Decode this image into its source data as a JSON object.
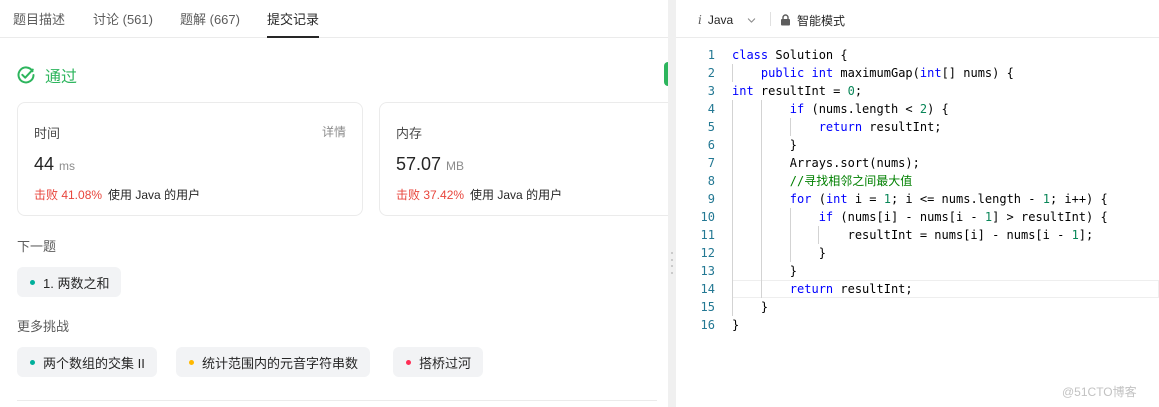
{
  "tabs": [
    {
      "label": "题目描述",
      "active": false
    },
    {
      "label": "讨论 (561)",
      "active": false
    },
    {
      "label": "题解 (667)",
      "active": false
    },
    {
      "label": "提交记录",
      "active": true
    }
  ],
  "result": {
    "status": "通过",
    "status_color": "#2db55d"
  },
  "runtime": {
    "label": "时间",
    "detail": "详情",
    "value": "44",
    "unit": "ms",
    "beat": "击败 41.08%",
    "beat_suffix": "使用 Java 的用户"
  },
  "memory": {
    "label": "内存",
    "value": "57.07",
    "unit": "MB",
    "beat": "击败 37.42%",
    "beat_suffix": "使用 Java 的用户"
  },
  "next_problem": {
    "title": "下一题",
    "item": {
      "label": "1. 两数之和",
      "dot_color": "#00af9b"
    }
  },
  "more_challenges": {
    "title": "更多挑战",
    "items": [
      {
        "label": "两个数组的交集 II",
        "dot_color": "#00af9b"
      },
      {
        "label": "统计范围内的元音字符串数",
        "dot_color": "#ffb800"
      },
      {
        "label": "搭桥过河",
        "dot_color": "#ff2d55"
      }
    ]
  },
  "editor": {
    "language": "Java",
    "language_icon": "i",
    "mode_label": "智能模式",
    "current_line": 14,
    "lines": [
      {
        "n": "1",
        "text": "class Solution {"
      },
      {
        "n": "2",
        "text": "    public int maximumGap(int[] nums) {"
      },
      {
        "n": "3",
        "text": "int resultInt = 0;"
      },
      {
        "n": "4",
        "text": "        if (nums.length < 2) {"
      },
      {
        "n": "5",
        "text": "            return resultInt;"
      },
      {
        "n": "6",
        "text": "        }"
      },
      {
        "n": "7",
        "text": "        Arrays.sort(nums);"
      },
      {
        "n": "8",
        "text": "        //寻找相邻之间最大值"
      },
      {
        "n": "9",
        "text": "        for (int i = 1; i <= nums.length - 1; i++) {"
      },
      {
        "n": "10",
        "text": "            if (nums[i] - nums[i - 1] > resultInt) {"
      },
      {
        "n": "11",
        "text": "                resultInt = nums[i] - nums[i - 1];"
      },
      {
        "n": "12",
        "text": "            }"
      },
      {
        "n": "13",
        "text": "        }"
      },
      {
        "n": "14",
        "text": "        return resultInt;"
      },
      {
        "n": "15",
        "text": "    }"
      },
      {
        "n": "16",
        "text": "}"
      }
    ]
  },
  "watermark": "@51CTO博客"
}
